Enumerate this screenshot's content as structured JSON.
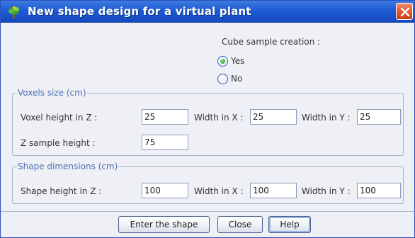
{
  "window": {
    "title": "New shape design for a virtual plant",
    "title_bar_color": "#1f5bd6",
    "app_icon": "plant-icon",
    "close_icon": "close-x-icon"
  },
  "cube_sample": {
    "label": "Cube sample creation :",
    "options": [
      {
        "label": "Yes",
        "selected": true
      },
      {
        "label": "No",
        "selected": false
      }
    ]
  },
  "voxels_group": {
    "legend": "Voxels size (cm)",
    "voxel_height_label": "Voxel height in Z :",
    "voxel_height_value": "25",
    "width_x_label": "Width in X :",
    "width_x_value": "25",
    "width_y_label": "Width in Y :",
    "width_y_value": "25",
    "z_sample_label": "Z sample height :",
    "z_sample_value": "75"
  },
  "shape_group": {
    "legend": "Shape dimensions (cm)",
    "shape_height_label": "Shape height in Z :",
    "shape_height_value": "100",
    "width_x_label": "Width in X :",
    "width_x_value": "100",
    "width_y_label": "Width in Y :",
    "width_y_value": "100"
  },
  "buttons": {
    "enter": "Enter the shape",
    "close": "Close",
    "help": "Help"
  }
}
